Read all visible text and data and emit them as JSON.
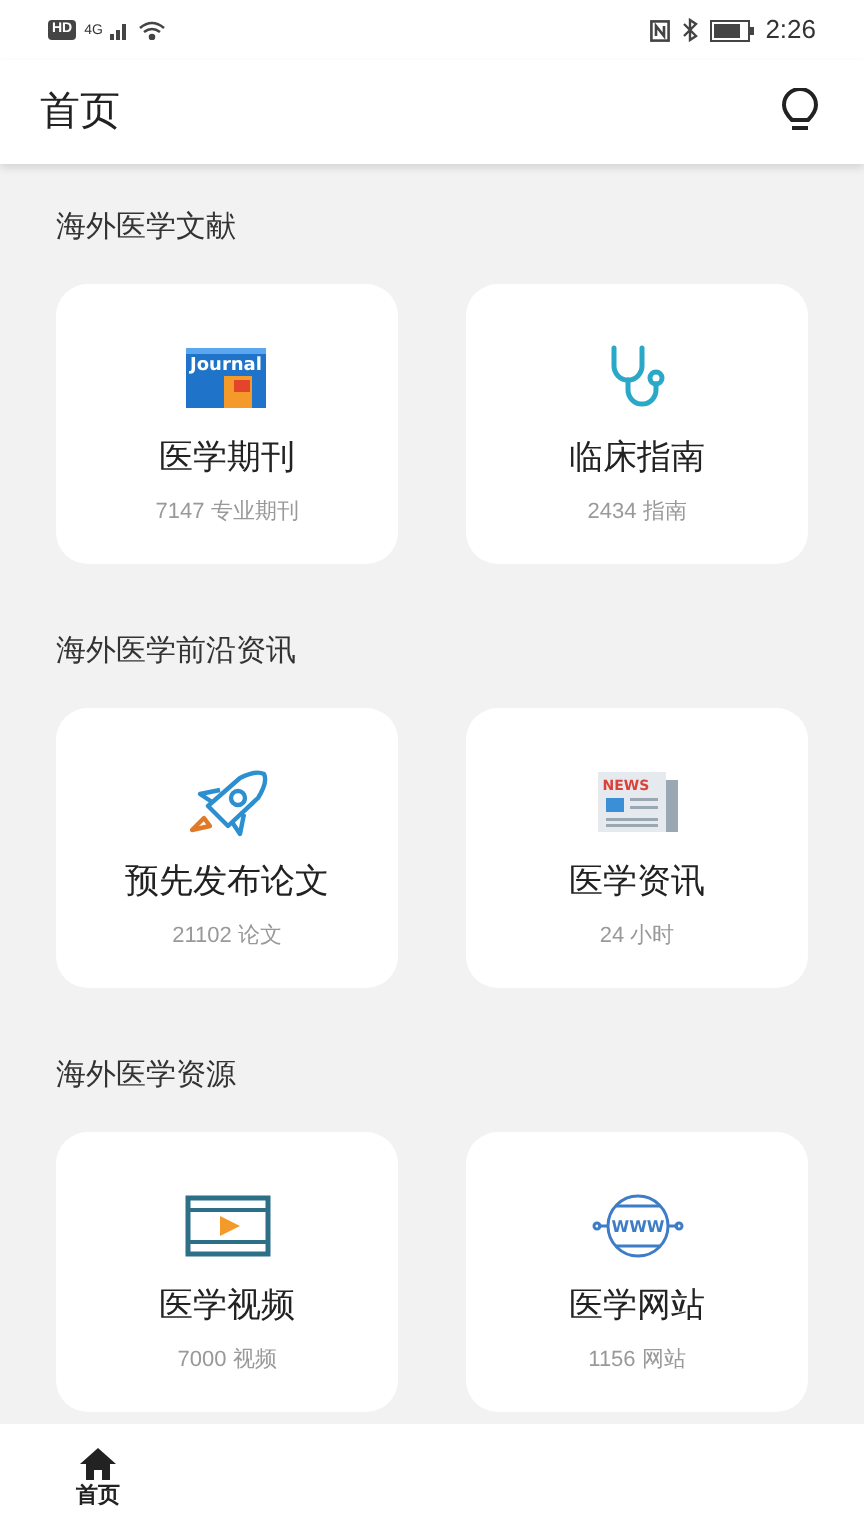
{
  "status_bar": {
    "badge": "HD",
    "network": "4G",
    "time": "2:26"
  },
  "header": {
    "title": "首页"
  },
  "sections": [
    {
      "title": "海外医学文献",
      "cards": [
        {
          "kind": "journal",
          "icon_text": "Journal",
          "title": "医学期刊",
          "subtitle": "7147 专业期刊"
        },
        {
          "kind": "stethoscope",
          "title": "临床指南",
          "subtitle": "2434 指南"
        }
      ]
    },
    {
      "title": "海外医学前沿资讯",
      "cards": [
        {
          "kind": "rocket",
          "title": "预先发布论文",
          "subtitle": "21102 论文"
        },
        {
          "kind": "news",
          "icon_text": "NEWS",
          "title": "医学资讯",
          "subtitle": "24 小时"
        }
      ]
    },
    {
      "title": "海外医学资源",
      "cards": [
        {
          "kind": "video",
          "title": "医学视频",
          "subtitle": "7000 视频"
        },
        {
          "kind": "web",
          "icon_text": "WWW",
          "title": "医学网站",
          "subtitle": "1156 网站"
        }
      ]
    }
  ],
  "bottom_nav": [
    {
      "label": "首页",
      "selected": true
    }
  ]
}
